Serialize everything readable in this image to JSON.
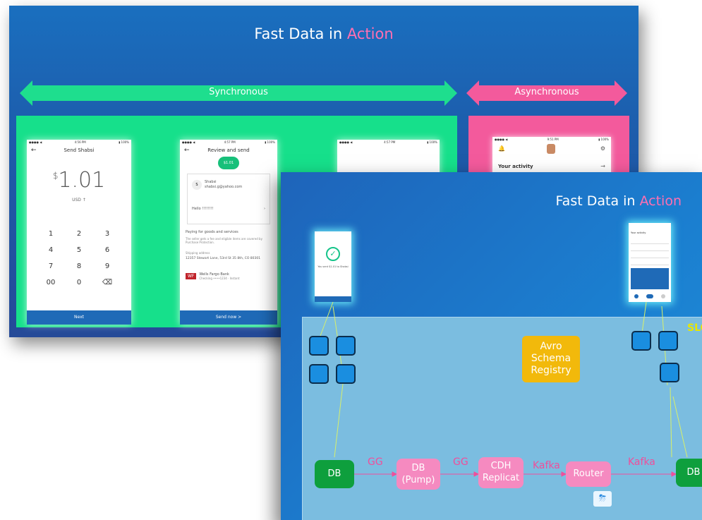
{
  "slide1": {
    "title_main": "Fast Data in ",
    "title_accent": "Action",
    "sync_label": "Synchronous",
    "async_label": "Asynchronous",
    "phone1": {
      "title": "Send Shabsi",
      "amount_symbol": "$",
      "amount": "1.01",
      "currency": "USD ↑",
      "keys": [
        "1",
        "2",
        "3",
        "4",
        "5",
        "6",
        "7",
        "8",
        "9",
        "00",
        "0",
        "⌫"
      ],
      "button": "Next"
    },
    "phone2": {
      "title": "Review and send",
      "amount_pill": "$1.01",
      "contact_name": "Shabsi",
      "contact_email": "shabsi.g@yahoo.com",
      "note": "Hello !!!!!!!!",
      "payment_purpose": "Paying for goods and services",
      "purpose_detail": "The seller gets a fee and eligible items are covered by Purchase Protection.",
      "shipping_label": "Shipping address",
      "shipping_address": "12357 Stewart Lane, 53rd St 35 8th, CO 80301",
      "bank_logo": "WF",
      "bank_name": "Wells Fargo Bank",
      "bank_detail": "Checking ••••1234 · Instant",
      "button": "Send now  >"
    },
    "phone3": {},
    "phone4": {
      "activity": "Your activity"
    }
  },
  "slide2": {
    "title_main": "Fast Data in ",
    "title_accent": "Action",
    "avro": "Avro Schema Registry",
    "avro_lines": [
      "Avro",
      "Schema",
      "Registry"
    ],
    "db_left": "DB",
    "db_right": "DB",
    "pump_lines": [
      "DB",
      "(Pump)"
    ],
    "cdh_lines": [
      "CDH",
      "Replicat"
    ],
    "router": "Router",
    "flow_labels": {
      "gg1": "GG",
      "gg2": "GG",
      "kafka1": "Kafka",
      "kafka2": "Kafka"
    },
    "slo": "SLO",
    "left_phone_text": "You sent $1.01 to Shabsi",
    "right_phone_text": "Your activity"
  },
  "colors": {
    "sync_green": "#1ede8e",
    "async_pink": "#f35a9c",
    "accent_pink": "#ff6fb2",
    "db_green": "#0e9f3d",
    "avro_yellow": "#f2b90b",
    "micro_blue": "#1a8ee0"
  }
}
